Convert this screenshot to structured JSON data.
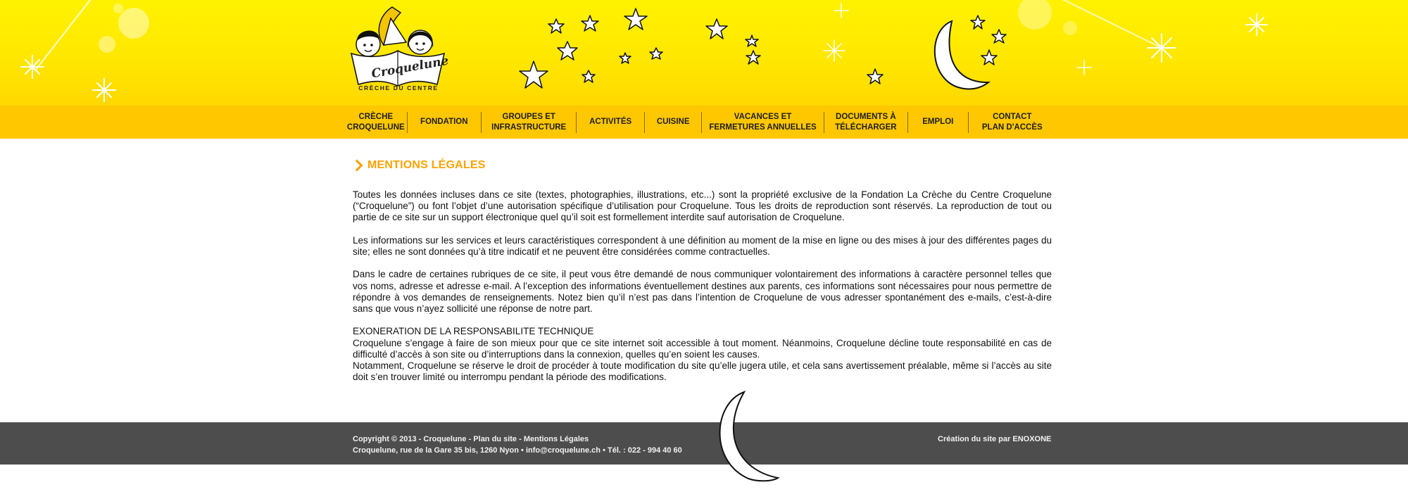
{
  "logo": {
    "script": "Croquelune",
    "subtitle": "CRÈCHE DU CENTRE"
  },
  "nav": {
    "items": [
      {
        "label_1": "CRÈCHE",
        "label_2": "CROQUELUNE"
      },
      {
        "label_1": "FONDATION",
        "label_2": ""
      },
      {
        "label_1": "GROUPES ET",
        "label_2": "INFRASTRUCTURE"
      },
      {
        "label_1": "ACTIVITÉS",
        "label_2": ""
      },
      {
        "label_1": "CUISINE",
        "label_2": ""
      },
      {
        "label_1": "VACANCES ET",
        "label_2": "FERMETURES ANNUELLES"
      },
      {
        "label_1": "DOCUMENTS À",
        "label_2": "TÉLÉCHARGER"
      },
      {
        "label_1": "EMPLOI",
        "label_2": ""
      },
      {
        "label_1": "CONTACT",
        "label_2": "PLAN  D'ACCÈS"
      }
    ]
  },
  "main": {
    "title": "MENTIONS LÉGALES",
    "paragraphs": [
      "Toutes les données incluses dans ce site (textes, photographies, illustrations, etc...) sont la propriété exclusive de la Fondation La Crèche du Centre Croquelune (“Croquelune”) ou font l’objet d’une autorisation spécifique d’utilisation pour Croquelune. Tous les droits de reproduction sont réservés. La reproduction de tout ou partie de ce site sur un support électronique quel qu’il soit est formellement interdite sauf autorisation de Croquelune.",
      "Les informations sur les services et leurs caractéristiques correspondent à une définition au moment de la mise en ligne ou des mises à jour des différentes pages du site; elles ne sont données qu’à titre indicatif et ne peuvent être considérées comme contractuelles.",
      "Dans le cadre de certaines rubriques de ce site, il peut vous être demandé de nous communiquer volontairement des informations à caractère personnel telles que vos noms, adresse et adresse e-mail. A l’exception des informations éventuellement destines aux parents, ces informations sont nécessaires pour nous permettre de répondre à vos demandes de renseignements. Notez bien qu’il n’est pas dans l’intention de Croquelune de vous adresser spontanément des e-mails, c’est-à-dire sans que vous n’ayez sollicité une réponse de notre part."
    ],
    "section_heading": "EXONERATION DE LA RESPONSABILITE TECHNIQUE",
    "section_para_1": "Croquelune s’engage à faire de son mieux pour que ce site internet soit accessible à tout moment. Néanmoins, Croquelune décline toute responsabilité en cas de difficulté d’accès à son site ou d’interruptions dans la connexion, quelles qu’en soient les causes.",
    "section_para_2": "Notamment, Croquelune se réserve le droit de procéder à toute modification du site qu’elle jugera utile, et cela sans avertissement préalable, même si l’accès au site doit s’en trouver limité ou interrompu pendant la période des modifications."
  },
  "footer": {
    "copyright": "Copyright © 2013 - Croquelune - ",
    "sitemap_link": "Plan du site",
    "separator": " - ",
    "legal_link": "Mentions Légales",
    "address": "Croquelune, rue de la Gare 35 bis, 1260 Nyon • ",
    "email": "info@croquelune.ch",
    "phone": " • Tél. : 022 - 994 40 60",
    "credit_prefix": "Création du site par ",
    "credit_link": "ENOXONE"
  },
  "colors": {
    "header_yellow": "#ffee00",
    "nav_yellow": "#ffc700",
    "title_orange": "#ffa300",
    "footer_gray": "#4d4d4d"
  }
}
